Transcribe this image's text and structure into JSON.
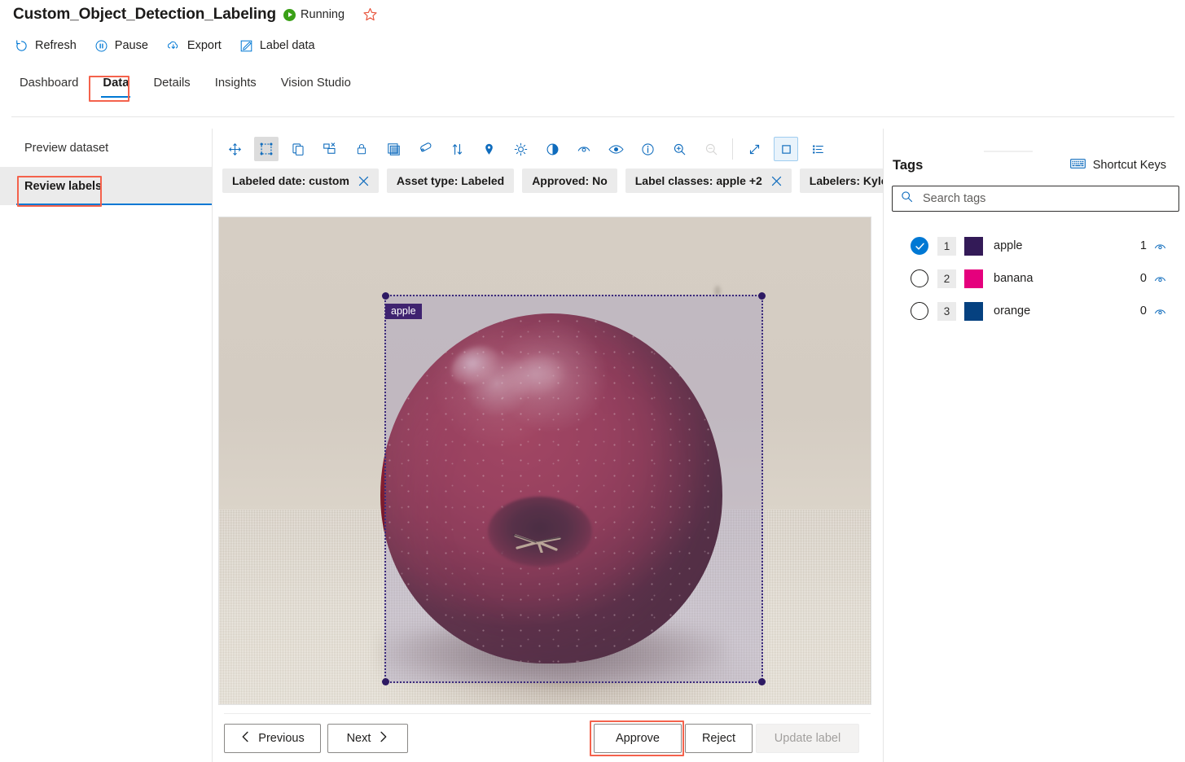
{
  "header": {
    "title": "Custom_Object_Detection_Labeling",
    "status": "Running",
    "status_icon": "play-circle-icon",
    "favorite_icon": "star-icon"
  },
  "commandbar": {
    "items": [
      {
        "label": "Refresh",
        "icon": "refresh-icon"
      },
      {
        "label": "Pause",
        "icon": "pause-circle-icon"
      },
      {
        "label": "Export",
        "icon": "cloud-download-icon"
      },
      {
        "label": "Label data",
        "icon": "edit-square-icon"
      }
    ]
  },
  "tabs": {
    "items": [
      {
        "label": "Dashboard",
        "active": false
      },
      {
        "label": "Data",
        "active": true
      },
      {
        "label": "Details",
        "active": false
      },
      {
        "label": "Insights",
        "active": false
      },
      {
        "label": "Vision Studio",
        "active": false
      }
    ]
  },
  "leftnav": {
    "items": [
      {
        "label": "Preview dataset",
        "selected": false
      },
      {
        "label": "Review labels",
        "selected": true
      }
    ]
  },
  "toolbar": {
    "tools": [
      {
        "name": "pan-move-icon",
        "state": "normal"
      },
      {
        "name": "draw-bounding-box-icon",
        "state": "active"
      },
      {
        "name": "copy-icon",
        "state": "normal"
      },
      {
        "name": "delete-region-icon",
        "state": "normal"
      },
      {
        "name": "lock-icon",
        "state": "normal"
      },
      {
        "name": "fill-region-icon",
        "state": "normal"
      },
      {
        "name": "tag-icon",
        "state": "normal"
      },
      {
        "name": "sort-icon",
        "state": "normal"
      },
      {
        "name": "location-pin-icon",
        "state": "normal"
      },
      {
        "name": "brightness-icon",
        "state": "normal"
      },
      {
        "name": "contrast-icon",
        "state": "normal"
      },
      {
        "name": "blur-icon",
        "state": "normal"
      },
      {
        "name": "visibility-icon",
        "state": "normal"
      },
      {
        "name": "info-icon",
        "state": "normal"
      },
      {
        "name": "zoom-in-icon",
        "state": "normal"
      },
      {
        "name": "zoom-out-icon",
        "state": "disabled"
      },
      {
        "name": "fit-screen-icon",
        "state": "normal"
      },
      {
        "name": "single-view-icon",
        "state": "boxed"
      },
      {
        "name": "list-view-icon",
        "state": "normal"
      }
    ]
  },
  "filters": {
    "chips": [
      {
        "label": "Labeled date: custom",
        "dismissible": true
      },
      {
        "label": "Asset type: Labeled",
        "dismissible": false
      },
      {
        "label": "Approved: No",
        "dismissible": false
      },
      {
        "label": "Label classes: apple +2",
        "dismissible": true
      },
      {
        "label": "Labelers: Kyle Bunting",
        "dismissible": true
      }
    ]
  },
  "canvas": {
    "region_label": "apple",
    "region_color": "#3f2370",
    "region_fill": "rgba(150,140,190,0.30)"
  },
  "actions": {
    "previous": "Previous",
    "next": "Next",
    "approve": "Approve",
    "reject": "Reject",
    "update_label": "Update label"
  },
  "tags": {
    "title": "Tags",
    "shortcut_keys": "Shortcut Keys",
    "shortcut_icon": "keyboard-icon",
    "search_placeholder": "Search tags",
    "search_value": "",
    "search_icon": "search-icon",
    "items": [
      {
        "index": "1",
        "name": "apple",
        "color": "#331a57",
        "count": "1",
        "selected": true
      },
      {
        "index": "2",
        "name": "banana",
        "color": "#e5007d",
        "count": "0",
        "selected": false
      },
      {
        "index": "3",
        "name": "orange",
        "color": "#054180",
        "count": "0",
        "selected": false
      }
    ]
  },
  "annotations": {
    "accent_color": "#f4624c",
    "highlights": [
      "tab-data",
      "nav-review-labels",
      "approve-button"
    ]
  }
}
